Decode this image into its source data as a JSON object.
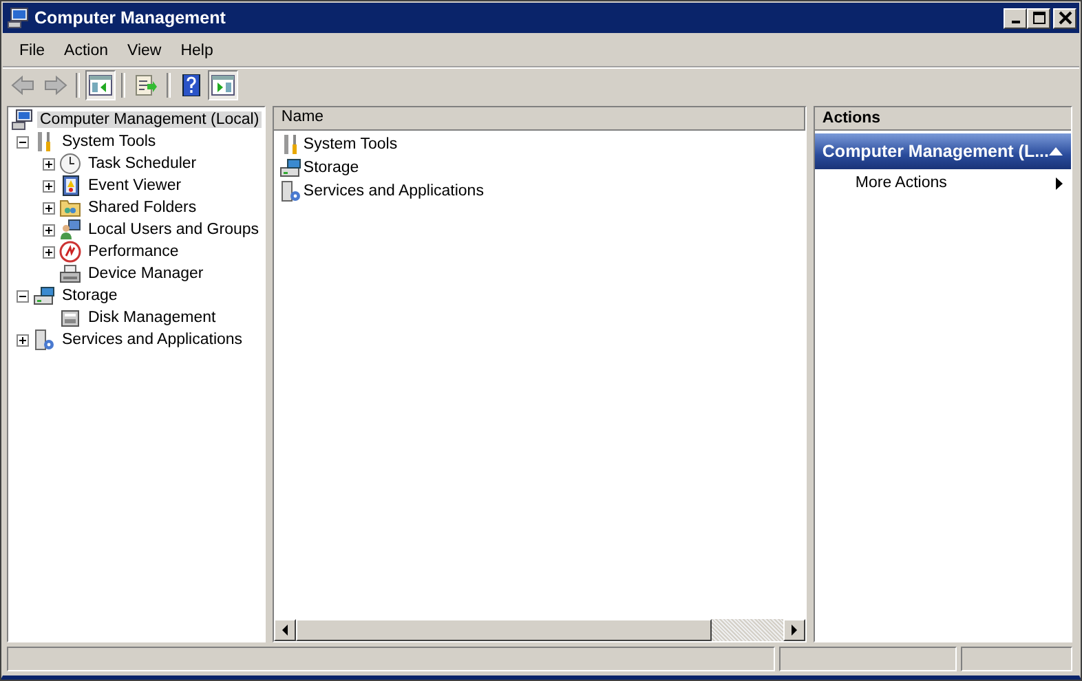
{
  "window": {
    "title": "Computer Management"
  },
  "menu": [
    {
      "label": "File"
    },
    {
      "label": "Action"
    },
    {
      "label": "View"
    },
    {
      "label": "Help"
    }
  ],
  "toolbar": [
    {
      "kind": "back",
      "disabled": true,
      "pressed": false
    },
    {
      "kind": "forward",
      "disabled": true,
      "pressed": false
    },
    {
      "kind": "separator"
    },
    {
      "kind": "tree",
      "pressed": true
    },
    {
      "kind": "separator"
    },
    {
      "kind": "export",
      "pressed": false
    },
    {
      "kind": "separator"
    },
    {
      "kind": "help",
      "pressed": false
    },
    {
      "kind": "actionpane",
      "pressed": true
    }
  ],
  "tree": {
    "label": "Computer Management (Local)",
    "selected": true,
    "children": [
      {
        "label": "System Tools",
        "selected": false,
        "expanded": true,
        "children": [
          {
            "label": "Task Scheduler",
            "selected": false,
            "expanded": false
          },
          {
            "label": "Event Viewer",
            "selected": false,
            "expanded": false
          },
          {
            "label": "Shared Folders",
            "selected": false,
            "expanded": false
          },
          {
            "label": "Local Users and Groups",
            "selected": false,
            "expanded": false
          },
          {
            "label": "Performance",
            "selected": false,
            "expanded": false
          },
          {
            "label": "Device Manager",
            "selected": false
          }
        ]
      },
      {
        "label": "Storage",
        "selected": false,
        "expanded": true,
        "children": [
          {
            "label": "Disk Management",
            "selected": false
          }
        ]
      },
      {
        "label": "Services and Applications",
        "selected": false,
        "expanded": false
      }
    ]
  },
  "list": {
    "columns": [
      "Name"
    ],
    "rows": [
      {
        "name": "System Tools",
        "selected": false
      },
      {
        "name": "Storage",
        "selected": false
      },
      {
        "name": "Services and Applications",
        "selected": false
      }
    ]
  },
  "actions": {
    "header": "Actions",
    "section": {
      "title": "Computer Management (L...",
      "expanded": true
    },
    "items": [
      {
        "label": "More Actions",
        "submenu": true
      }
    ]
  }
}
